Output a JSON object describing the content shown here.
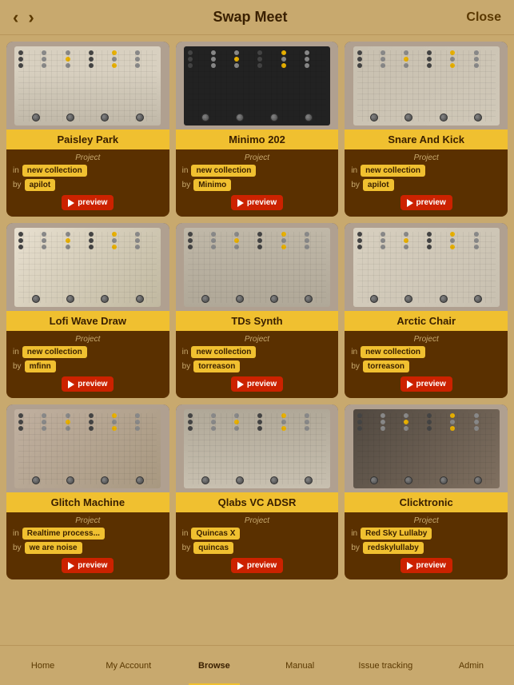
{
  "header": {
    "title": "Swap Meet",
    "close_label": "Close",
    "back_arrow": "‹",
    "forward_arrow": "›"
  },
  "cards": [
    {
      "id": "paisley-park",
      "title": "Paisley Park",
      "type": "Project",
      "collection": "new collection",
      "author": "apilot",
      "preview_label": "preview",
      "module_style": "mod-paisley"
    },
    {
      "id": "minimo-202",
      "title": "Minimo 202",
      "type": "Project",
      "collection": "new collection",
      "author": "Minimo",
      "preview_label": "preview",
      "module_style": "mod-minimo"
    },
    {
      "id": "snare-and-kick",
      "title": "Snare And Kick",
      "type": "Project",
      "collection": "new collection",
      "author": "apilot",
      "preview_label": "preview",
      "module_style": "mod-snare"
    },
    {
      "id": "lofi-wave-draw",
      "title": "Lofi Wave Draw",
      "type": "Project",
      "collection": "new collection",
      "author": "mfinn",
      "preview_label": "preview",
      "module_style": "mod-lofi"
    },
    {
      "id": "tds-synth",
      "title": "TDs Synth",
      "type": "Project",
      "collection": "new collection",
      "author": "torreason",
      "preview_label": "preview",
      "module_style": "mod-tds"
    },
    {
      "id": "arctic-chair",
      "title": "Arctic Chair",
      "type": "Project",
      "collection": "new collection",
      "author": "torreason",
      "preview_label": "preview",
      "module_style": "mod-arctic"
    },
    {
      "id": "glitch-machine",
      "title": "Glitch Machine",
      "type": "Project",
      "collection": "Realtime process...",
      "author": "we are noise",
      "preview_label": "preview",
      "module_style": "mod-glitch",
      "collection_red": false
    },
    {
      "id": "qlabs-vc-adsr",
      "title": "Qlabs VC ADSR",
      "type": "Project",
      "collection": "Quincas X",
      "author": "quincas",
      "preview_label": "preview",
      "module_style": "mod-qlabs",
      "collection_red": false
    },
    {
      "id": "clicktronic",
      "title": "Clicktronic",
      "type": "Project",
      "collection": "Red Sky Lullaby",
      "author": "redskylullaby",
      "preview_label": "preview",
      "module_style": "mod-click",
      "collection_red": false
    }
  ],
  "nav": {
    "items": [
      {
        "id": "home",
        "label": "Home"
      },
      {
        "id": "my-account",
        "label": "My Account"
      },
      {
        "id": "browse",
        "label": "Browse",
        "active": true
      },
      {
        "id": "manual",
        "label": "Manual"
      },
      {
        "id": "issue-tracking",
        "label": "Issue tracking"
      },
      {
        "id": "admin",
        "label": "Admin"
      }
    ]
  },
  "labels": {
    "in": "in",
    "by": "by",
    "type_project": "Project"
  }
}
